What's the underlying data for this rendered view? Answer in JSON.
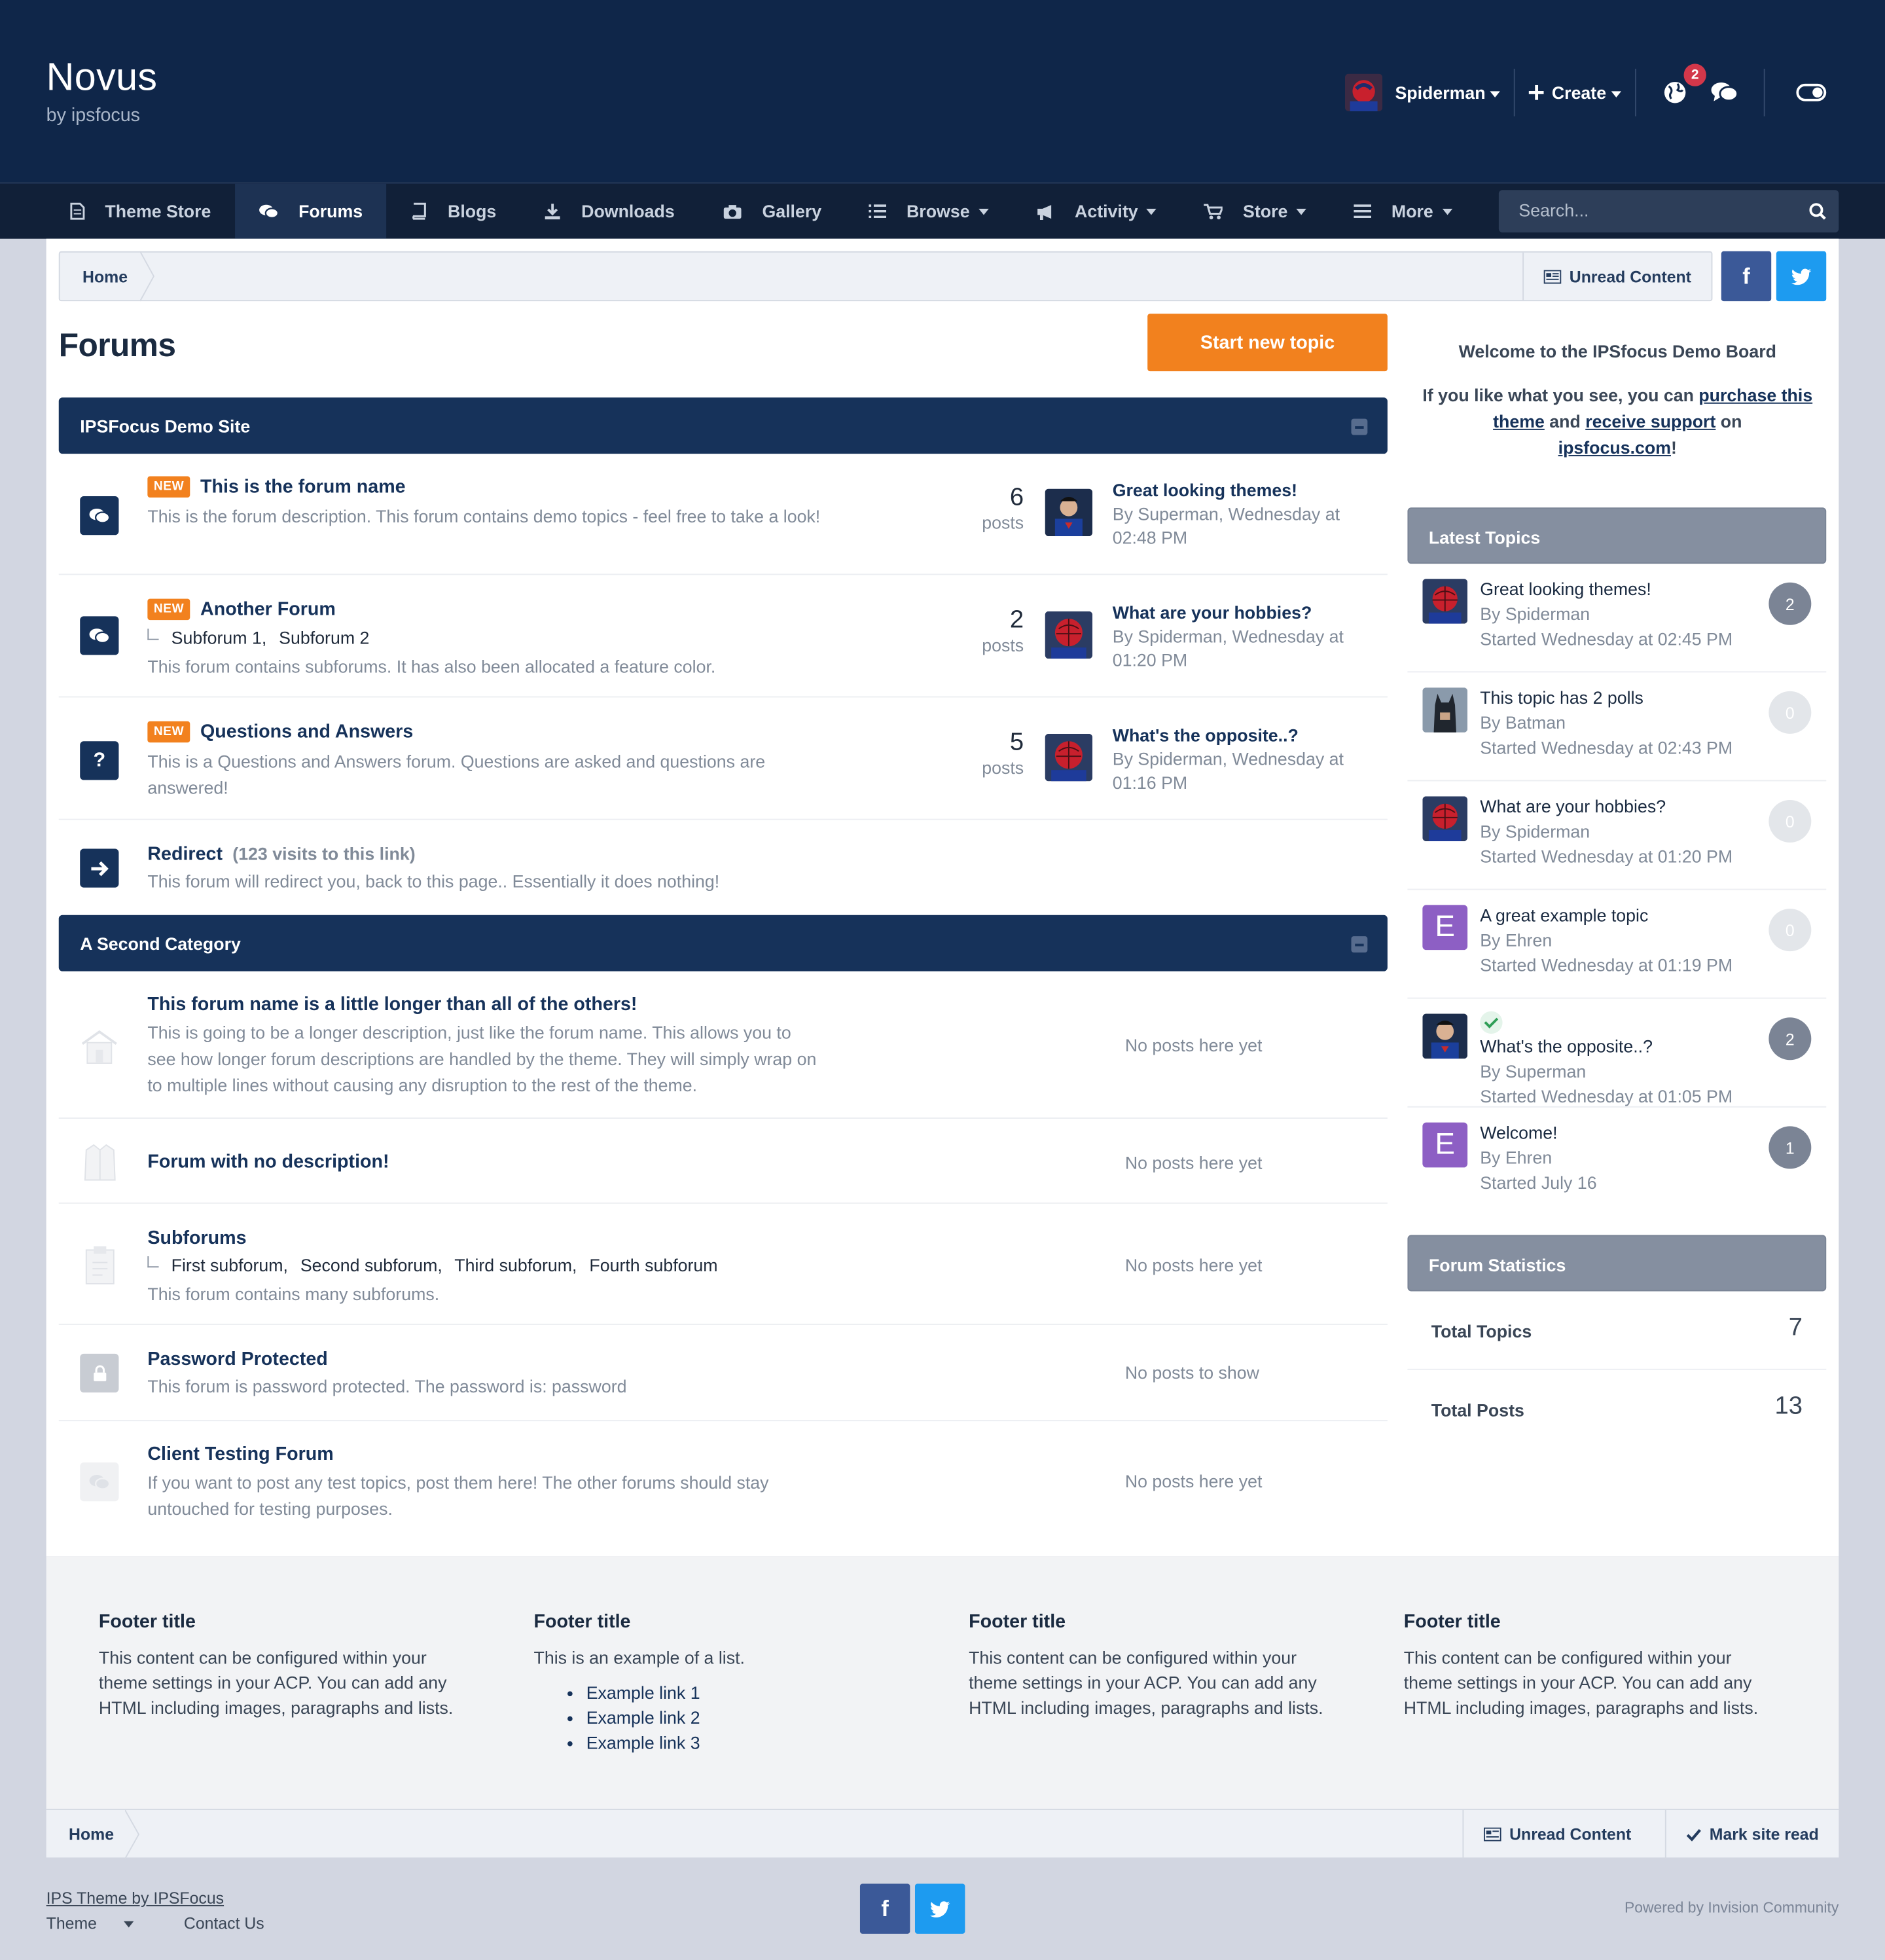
{
  "header": {
    "brand_title": "Novus",
    "brand_sub": "by ipsfocus",
    "username": "Spiderman",
    "create_label": "Create",
    "notification_count": "2"
  },
  "nav": {
    "items": [
      {
        "label": "Theme Store",
        "icon": "document-icon"
      },
      {
        "label": "Forums",
        "icon": "chat-icon",
        "active": true
      },
      {
        "label": "Blogs",
        "icon": "book-icon"
      },
      {
        "label": "Downloads",
        "icon": "download-icon"
      },
      {
        "label": "Gallery",
        "icon": "camera-icon"
      },
      {
        "label": "Browse",
        "icon": "list-icon"
      },
      {
        "label": "Activity",
        "icon": "megaphone-icon"
      },
      {
        "label": "Store",
        "icon": "cart-icon"
      },
      {
        "label": "More",
        "icon": "menu-icon"
      }
    ],
    "search_placeholder": "Search..."
  },
  "breadcrumb": {
    "home": "Home",
    "unread": "Unread Content"
  },
  "page": {
    "title": "Forums",
    "start_topic": "Start new topic"
  },
  "categories": [
    {
      "title": "IPSFocus Demo Site"
    },
    {
      "title": "A Second Category"
    }
  ],
  "forums1": [
    {
      "name": "This is the forum name",
      "badge": "NEW",
      "desc": "This is the forum description. This forum contains demo topics - feel free to take a look!",
      "count": "6",
      "count_label": "posts",
      "last_title": "Great looking themes!",
      "last_by": "By Superman, Wednesday at 02:48 PM"
    },
    {
      "name": "Another Forum",
      "badge": "NEW",
      "subs": [
        "Subforum 1,",
        "Subforum 2"
      ],
      "desc": "This forum contains subforums. It has also been allocated a feature color.",
      "count": "2",
      "count_label": "posts",
      "last_title": "What are your hobbies?",
      "last_by": "By Spiderman, Wednesday at 01:20 PM"
    },
    {
      "name": "Questions and Answers",
      "badge": "NEW",
      "desc": "This is a Questions and Answers forum. Questions are asked and questions are answered!",
      "count": "5",
      "count_label": "posts",
      "last_title": "What's the opposite..?",
      "last_by": "By Spiderman, Wednesday at 01:16 PM"
    },
    {
      "name": "Redirect",
      "visits": "(123 visits to this link)",
      "desc": "This forum will redirect you, back to this page.. Essentially it does nothing!"
    }
  ],
  "forums2": [
    {
      "name": "This forum name is a little longer than all of the others!",
      "desc": "This is going to be a longer description, just like the forum name. This allows you to see how longer forum descriptions are handled by the theme. They will simply wrap on to multiple lines without causing any disruption to the rest of the theme.",
      "status": "No posts here yet"
    },
    {
      "name": "Forum with no description!",
      "status": "No posts here yet"
    },
    {
      "name": "Subforums",
      "subs": [
        "First subforum,",
        "Second subforum,",
        "Third subforum,",
        "Fourth subforum"
      ],
      "desc": "This forum contains many subforums.",
      "status": "No posts here yet"
    },
    {
      "name": "Password Protected",
      "desc": "This forum is password protected. The password is: password",
      "status": "No posts to show"
    },
    {
      "name": "Client Testing Forum",
      "desc": "If you want to post any test topics, post them here! The other forums should stay untouched for testing purposes.",
      "status": "No posts here yet"
    }
  ],
  "sidebar": {
    "welcome_title": "Welcome to the IPSfocus Demo Board",
    "welcome_a": "If you like what you see, you can",
    "welcome_link1": "purchase this theme",
    "welcome_and": "and",
    "welcome_link2": "receive support",
    "welcome_on": "on",
    "welcome_link3": "ipsfocus.com",
    "welcome_end": "!",
    "latest_title": "Latest Topics",
    "topics": [
      {
        "title": "Great looking themes!",
        "by": "By Spiderman",
        "started": "Started Wednesday at 02:45 PM",
        "replies": "2",
        "avatar": "spiderman"
      },
      {
        "title": "This topic has 2 polls",
        "by": "By Batman",
        "started": "Started Wednesday at 02:43 PM",
        "replies": "0",
        "avatar": "batman"
      },
      {
        "title": "What are your hobbies?",
        "by": "By Spiderman",
        "started": "Started Wednesday at 01:20 PM",
        "replies": "0",
        "avatar": "spiderman"
      },
      {
        "title": "A great example topic",
        "by": "By Ehren",
        "started": "Started Wednesday at 01:19 PM",
        "replies": "0",
        "avatar": "E"
      },
      {
        "title": "What's the opposite..?",
        "by": "By Superman",
        "started": "Started Wednesday at 01:05 PM",
        "replies": "2",
        "avatar": "superman",
        "solved": true
      },
      {
        "title": "Welcome!",
        "by": "By Ehren",
        "started": "Started July 16",
        "replies": "1",
        "avatar": "E"
      }
    ],
    "stats_title": "Forum Statistics",
    "stats": [
      {
        "label": "Total Topics",
        "value": "7"
      },
      {
        "label": "Total Posts",
        "value": "13"
      }
    ]
  },
  "footer": {
    "cols": [
      {
        "title": "Footer title",
        "text": "This content can be configured within your theme settings in your ACP. You can add any HTML including images, paragraphs and lists."
      },
      {
        "title": "Footer title",
        "text": "This is an example of a list.",
        "list": [
          "Example link 1",
          "Example link 2",
          "Example link 3"
        ]
      },
      {
        "title": "Footer title",
        "text": "This content can be configured within your theme settings in your ACP. You can add any HTML including images, paragraphs and lists."
      },
      {
        "title": "Footer title",
        "text": "This content can be configured within your theme settings in your ACP. You can add any HTML including images, paragraphs and lists."
      }
    ],
    "bottom_home": "Home",
    "bottom_unread": "Unread Content",
    "bottom_mark": "Mark site read",
    "copyright": "IPS Theme by IPSFocus",
    "theme_label": "Theme",
    "contact_label": "Contact Us",
    "powered": "Powered by Invision Community",
    "fb_glyph": "f"
  },
  "colors": {
    "brand": "#0f2649",
    "accent": "#f2811e",
    "category": "#16325a",
    "sidebar_head": "#858fa0"
  }
}
